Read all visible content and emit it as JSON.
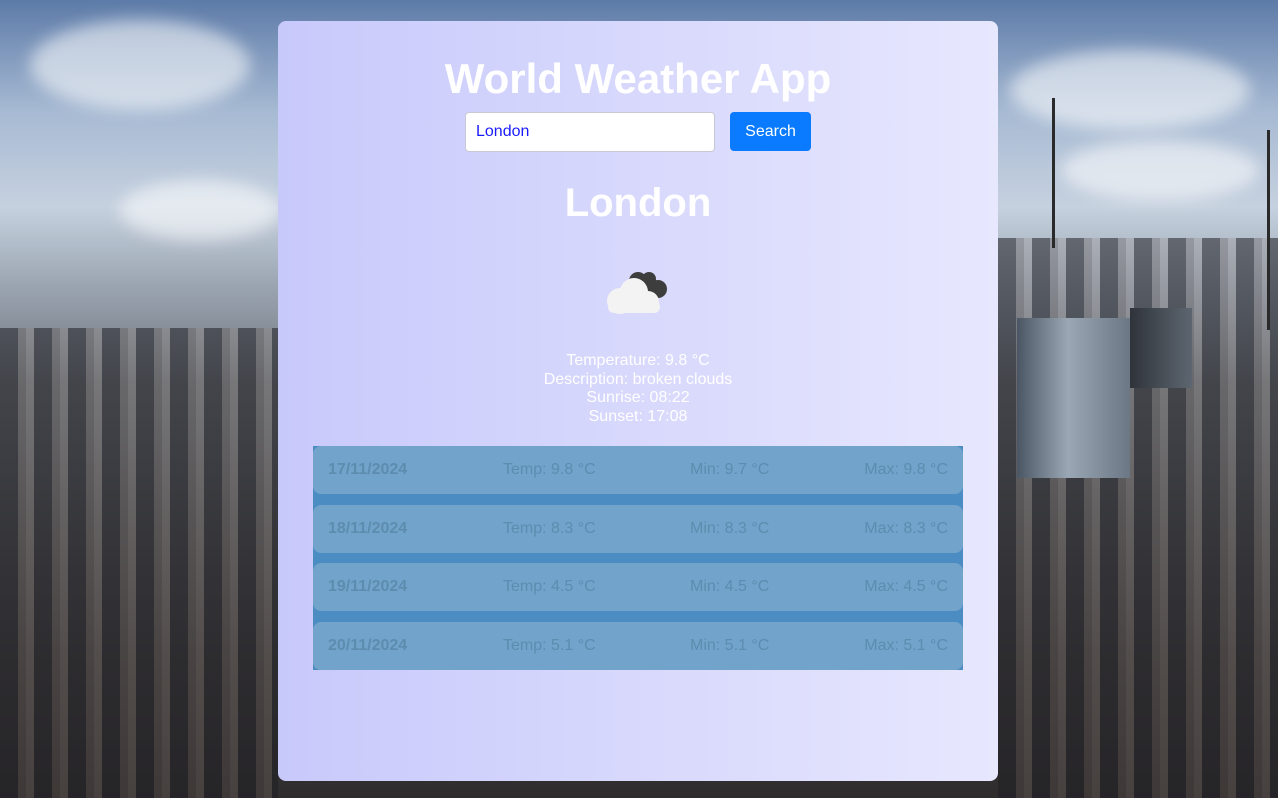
{
  "app": {
    "title": "World Weather App"
  },
  "search": {
    "value": "London",
    "button_label": "Search"
  },
  "current": {
    "city": "London",
    "icon": "broken-clouds-icon",
    "temperature": "Temperature: 9.8 °C",
    "description": "Description: broken clouds",
    "sunrise": "Sunrise: 08:22",
    "sunset": "Sunset: 17:08"
  },
  "forecast": [
    {
      "date": "17/11/2024",
      "temp": "Temp: 9.8 °C",
      "min": "Min: 9.7 °C",
      "max": "Max: 9.8 °C"
    },
    {
      "date": "18/11/2024",
      "temp": "Temp: 8.3 °C",
      "min": "Min: 8.3 °C",
      "max": "Max: 8.3 °C"
    },
    {
      "date": "19/11/2024",
      "temp": "Temp: 4.5 °C",
      "min": "Min: 4.5 °C",
      "max": "Max: 4.5 °C"
    },
    {
      "date": "20/11/2024",
      "temp": "Temp: 5.1 °C",
      "min": "Min: 5.1 °C",
      "max": "Max: 5.1 °C"
    }
  ],
  "colors": {
    "button": "#0a7bff",
    "forecast_panel": "#4b8cc2",
    "forecast_row": "#71a3cb"
  }
}
